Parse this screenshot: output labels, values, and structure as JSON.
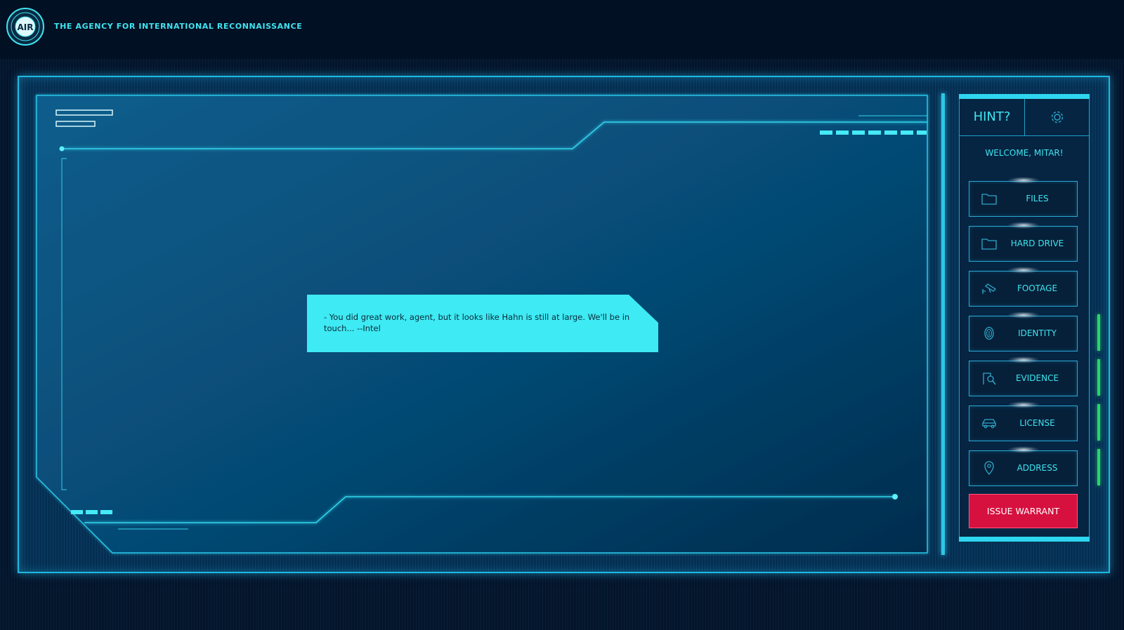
{
  "header": {
    "agency_title": "THE AGENCY FOR INTERNATIONAL RECONNAISSANCE",
    "logo_icon": "agency-seal-icon",
    "logo_text": "AIR"
  },
  "message": {
    "text": "- You did great work, agent, but it looks like Hahn is still at large. We'll be in touch... --Intel"
  },
  "panel": {
    "hint_label": "HINT?",
    "settings_icon": "gear-icon",
    "welcome": "WELCOME, MITAR!",
    "buttons": [
      {
        "label": "FILES",
        "icon": "folder-icon"
      },
      {
        "label": "HARD DRIVE",
        "icon": "folder-icon"
      },
      {
        "label": "FOOTAGE",
        "icon": "security-camera-icon"
      },
      {
        "label": "IDENTITY",
        "icon": "fingerprint-icon"
      },
      {
        "label": "EVIDENCE",
        "icon": "evidence-magnifier-icon"
      },
      {
        "label": "LICENSE",
        "icon": "car-icon"
      },
      {
        "label": "ADDRESS",
        "icon": "location-pin-icon"
      }
    ],
    "warrant_label": "ISSUE WARRANT"
  },
  "colors": {
    "accent": "#3fe4ee",
    "frame": "#1fb8e0",
    "warrant": "#d6103f",
    "status_green": "#29d66a"
  }
}
